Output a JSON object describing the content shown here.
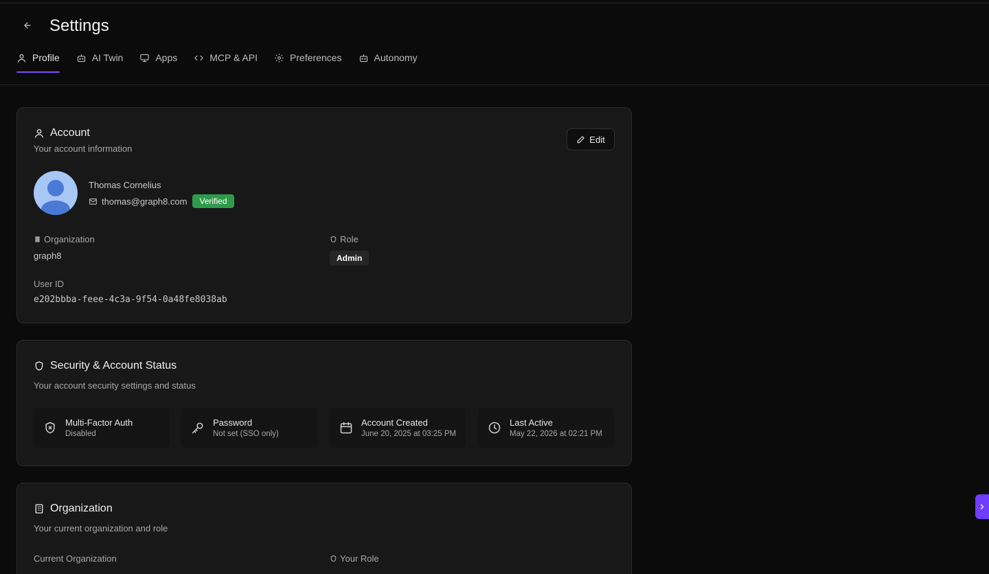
{
  "page": {
    "title": "Settings",
    "back_icon": "arrow-left-icon"
  },
  "tabs": [
    {
      "label": "Profile",
      "icon": "user-icon",
      "active": true
    },
    {
      "label": "AI Twin",
      "icon": "bot-icon"
    },
    {
      "label": "Apps",
      "icon": "monitor-icon"
    },
    {
      "label": "MCP & API",
      "icon": "code-icon"
    },
    {
      "label": "Preferences",
      "icon": "gear-icon"
    },
    {
      "label": "Autonomy",
      "icon": "bot-icon"
    }
  ],
  "account": {
    "title": "Account",
    "subtitle": "Your account information",
    "edit_label": "Edit",
    "name": "Thomas Cornelius",
    "email": "thomas@graph8.com",
    "verified_label": "Verified",
    "org_label": "Organization",
    "org_value": "graph8",
    "role_label": "Role",
    "role_value": "Admin",
    "user_id_label": "User ID",
    "user_id_value": "e202bbba-feee-4c3a-9f54-0a48fe8038ab"
  },
  "security": {
    "title": "Security & Account Status",
    "subtitle": "Your account security settings and status",
    "tiles": [
      {
        "title": "Multi-Factor Auth",
        "sub": "Disabled",
        "icon": "shield-x-icon"
      },
      {
        "title": "Password",
        "sub": "Not set (SSO only)",
        "icon": "key-icon"
      },
      {
        "title": "Account Created",
        "sub": "June 20, 2025 at 03:25 PM",
        "icon": "calendar-icon"
      },
      {
        "title": "Last Active",
        "sub": "May 22, 2026 at 02:21 PM",
        "icon": "clock-icon"
      }
    ]
  },
  "organization": {
    "title": "Organization",
    "subtitle": "Your current organization and role",
    "current_org_label": "Current Organization",
    "your_role_label": "Your Role"
  },
  "colors": {
    "accent": "#7c4dff",
    "verified": "#2e9b4b",
    "background": "#0b0b0b",
    "card": "#181818"
  }
}
